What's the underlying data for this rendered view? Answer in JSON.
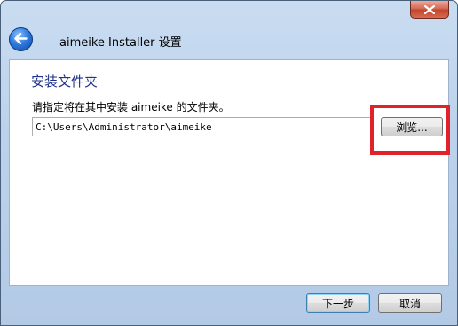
{
  "window": {
    "title": "aimeike Installer 设置"
  },
  "page": {
    "heading": "安装文件夹",
    "instruction": "请指定将在其中安装 aimeike 的文件夹。",
    "path_value": "C:\\Users\\Administrator\\aimeike",
    "browse_label": "浏览..."
  },
  "footer": {
    "next_label": "下一步",
    "cancel_label": "取消"
  },
  "colors": {
    "heading": "#1e3287",
    "highlight": "#e0232a",
    "close": "#c3452c"
  },
  "icons": {
    "close": "close-icon",
    "back": "back-arrow-icon"
  }
}
